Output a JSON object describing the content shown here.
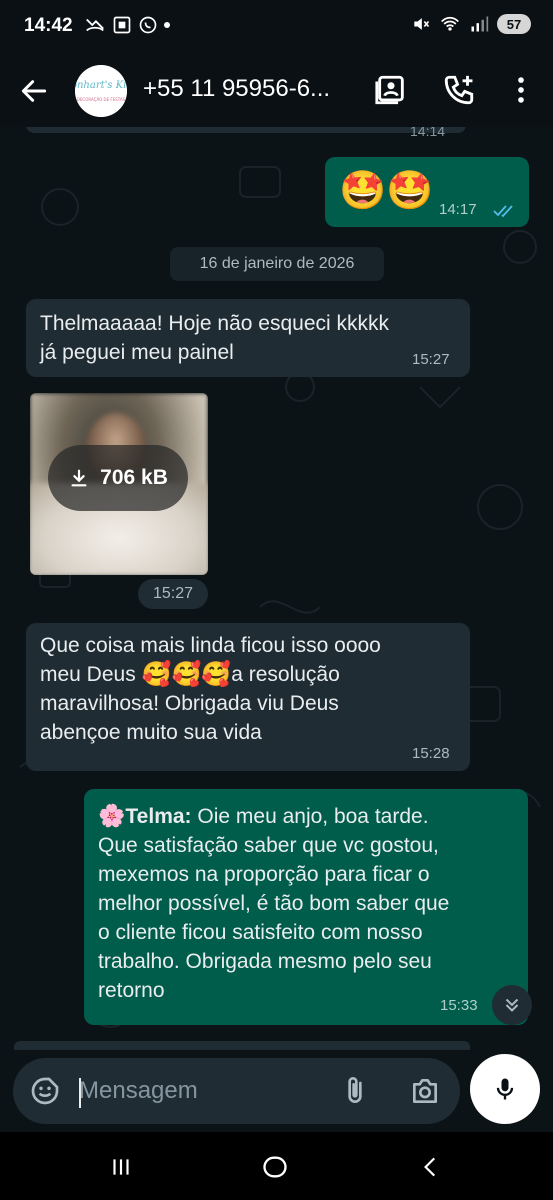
{
  "status_bar": {
    "time": "14:42",
    "battery": "57"
  },
  "header": {
    "contact_name": "+55 11 95956-6...",
    "avatar_text": "Sonhart's Kids",
    "avatar_subtext": "DECORAÇÃO DE FESTAS"
  },
  "chat": {
    "previous_time": "14:14",
    "messages": [
      {
        "direction": "out",
        "emoji": "🤩🤩",
        "time": "14:17",
        "status": "read"
      },
      {
        "type": "date",
        "label": "16 de janeiro de 2026"
      },
      {
        "direction": "in",
        "text": "Thelmaaaaa! Hoje não esqueci kkkkk já peguei meu painel",
        "line1": "Thelmaaaaa! Hoje não esqueci kkkkk",
        "line2": "já peguei meu painel",
        "time": "15:27"
      },
      {
        "direction": "in",
        "type": "image",
        "size": "706 kB",
        "time": "15:27"
      },
      {
        "direction": "in",
        "line1a": "Que coisa mais linda ficou isso oooo",
        "line2a": "meu Deus",
        "emoji": "🥰🥰🥰",
        "line2b": "a resolução",
        "line3": "maravilhosa! Obrigada viu Deus",
        "line4": "abençoe muito sua vida",
        "time": "15:28"
      },
      {
        "direction": "out",
        "sender_emoji": "🌸",
        "sender": "Telma:",
        "line1": " Oie meu anjo, boa tarde.",
        "line2": "Que satisfação saber que vc gostou,",
        "line3": "mexemos na proporção para ficar o",
        "line4": "melhor possível, é tão bom saber que",
        "line5": "o cliente ficou satisfeito com nosso",
        "line6": "trabalho. Obrigada mesmo pelo seu",
        "line7": "retorno",
        "time": "15:33"
      }
    ]
  },
  "input": {
    "placeholder": "Mensagem"
  },
  "colors": {
    "outgoing_bubble": "#005c4b",
    "incoming_bubble": "#1f2c33",
    "read_ticks": "#53bdeb",
    "background": "#0c1317"
  }
}
